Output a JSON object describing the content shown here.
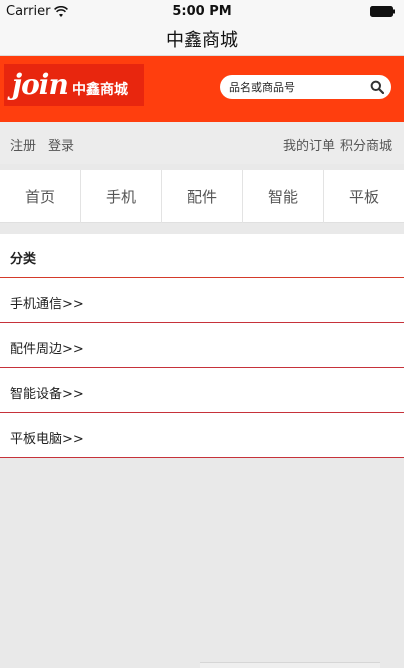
{
  "status_bar": {
    "carrier": "Carrier",
    "time": "5:00 PM"
  },
  "nav": {
    "title": "中鑫商城"
  },
  "banner": {
    "logo_mark": "join",
    "logo_text": "中鑫商城",
    "search_placeholder": "品名或商品号"
  },
  "user_links": {
    "register": "注册",
    "login": "登录",
    "my_orders": "我的订单",
    "points_mall": "积分商城"
  },
  "tabs": [
    "首页",
    "手机",
    "配件",
    "智能",
    "平板"
  ],
  "categories": {
    "header": "分类",
    "items": [
      "手机通信>>",
      "配件周边>>",
      "智能设备>>",
      "平板电脑>>"
    ]
  },
  "colors": {
    "banner": "#ff3e0e",
    "logo_bg": "#e8260e",
    "divider": "#c6323a"
  }
}
